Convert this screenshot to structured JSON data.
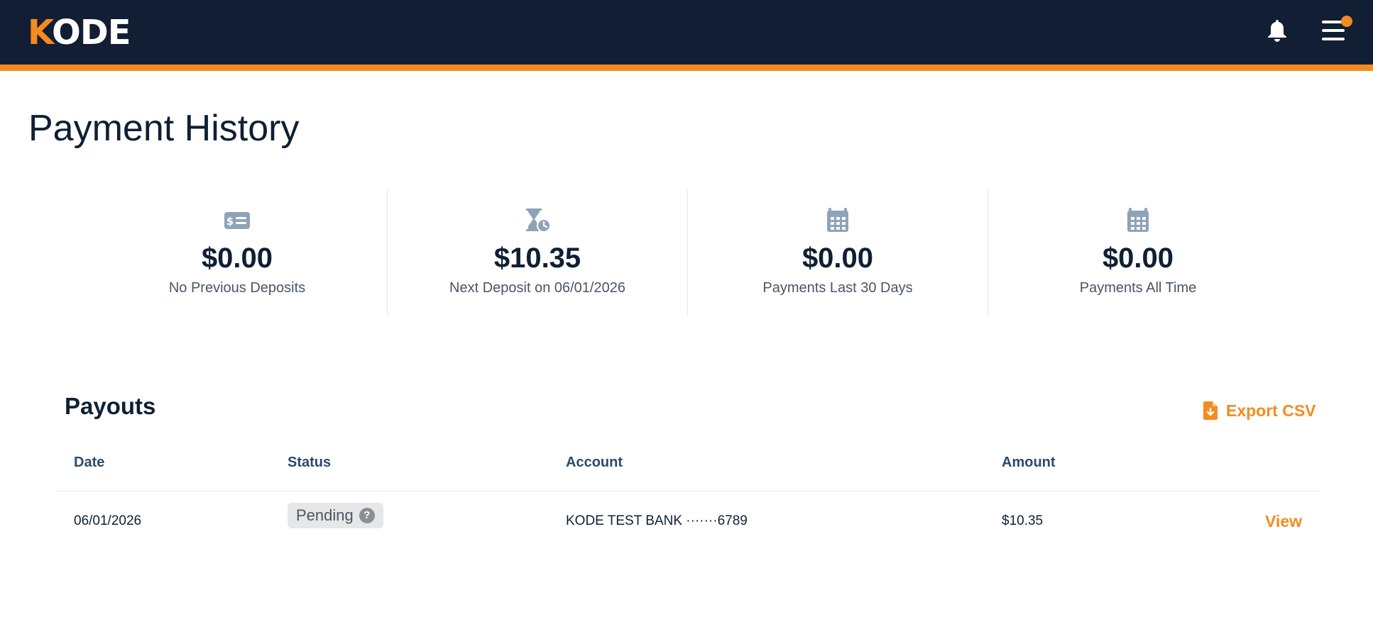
{
  "header": {
    "logo_first": "K",
    "logo_rest": "ODE",
    "brand_color": "#f58a20",
    "bar_color": "#111e33",
    "icons": [
      "bell-icon",
      "menu-icon"
    ]
  },
  "page": {
    "title": "Payment History"
  },
  "stats": [
    {
      "icon": "money-card-icon",
      "value": "$0.00",
      "label": "No Previous Deposits"
    },
    {
      "icon": "hourglass-clock-icon",
      "value": "$10.35",
      "label": "Next Deposit on 06/01/2026"
    },
    {
      "icon": "calendar-icon",
      "value": "$0.00",
      "label": "Payments Last 30 Days"
    },
    {
      "icon": "calendar-icon",
      "value": "$0.00",
      "label": "Payments All Time"
    }
  ],
  "payouts": {
    "title": "Payouts",
    "export_label": "Export CSV",
    "columns": [
      "Date",
      "Status",
      "Account",
      "Amount"
    ],
    "rows": [
      {
        "date": "06/01/2026",
        "status": "Pending",
        "account": "KODE TEST BANK ·······6789",
        "amount": "$10.35",
        "action": "View"
      }
    ]
  }
}
